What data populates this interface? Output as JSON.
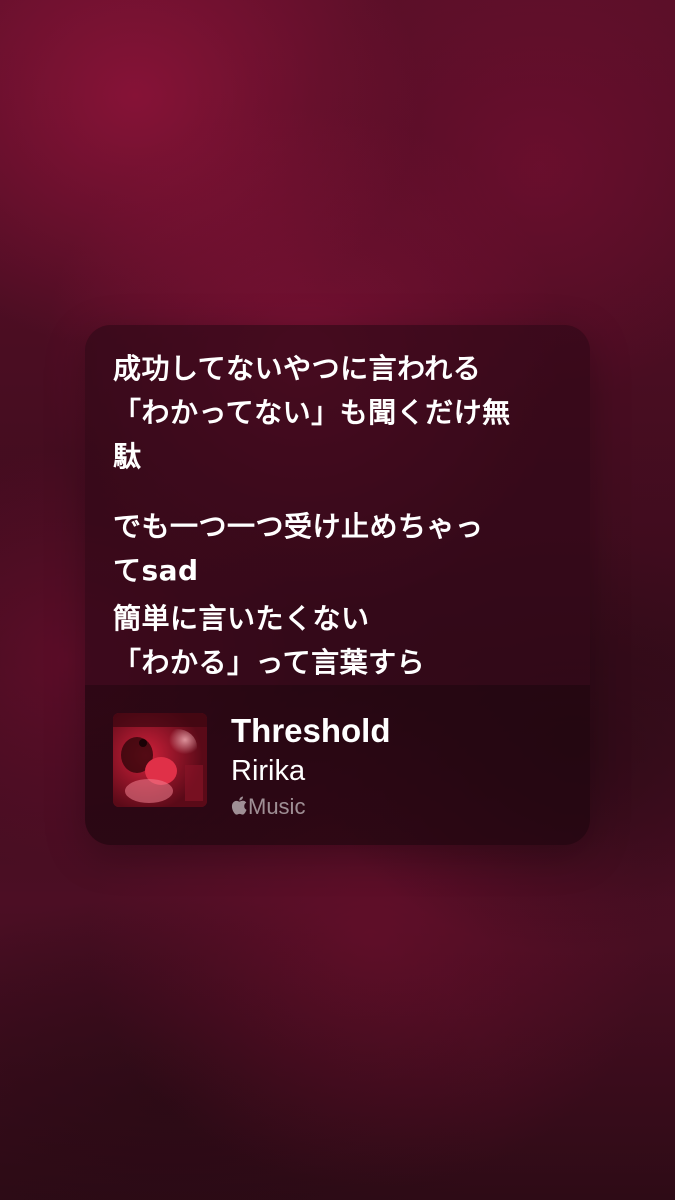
{
  "lyrics": {
    "blocks": [
      {
        "lines": [
          "成功してないやつに言われる",
          "「わかってない」も聞くだけ無",
          "駄"
        ]
      },
      {
        "lines": [
          "でも一つ一つ受け止めちゃっ",
          "てsad"
        ]
      },
      {
        "lines": [
          "簡単に言いたくない",
          "「わかる」って言葉すら"
        ]
      }
    ]
  },
  "track": {
    "title": "Threshold",
    "artist": "Ririka",
    "service_label": "Music",
    "service_icon": "apple-logo-icon"
  },
  "colors": {
    "background": "#4a0d22",
    "text_primary": "#ffffff",
    "text_secondary": "#a88a94"
  }
}
